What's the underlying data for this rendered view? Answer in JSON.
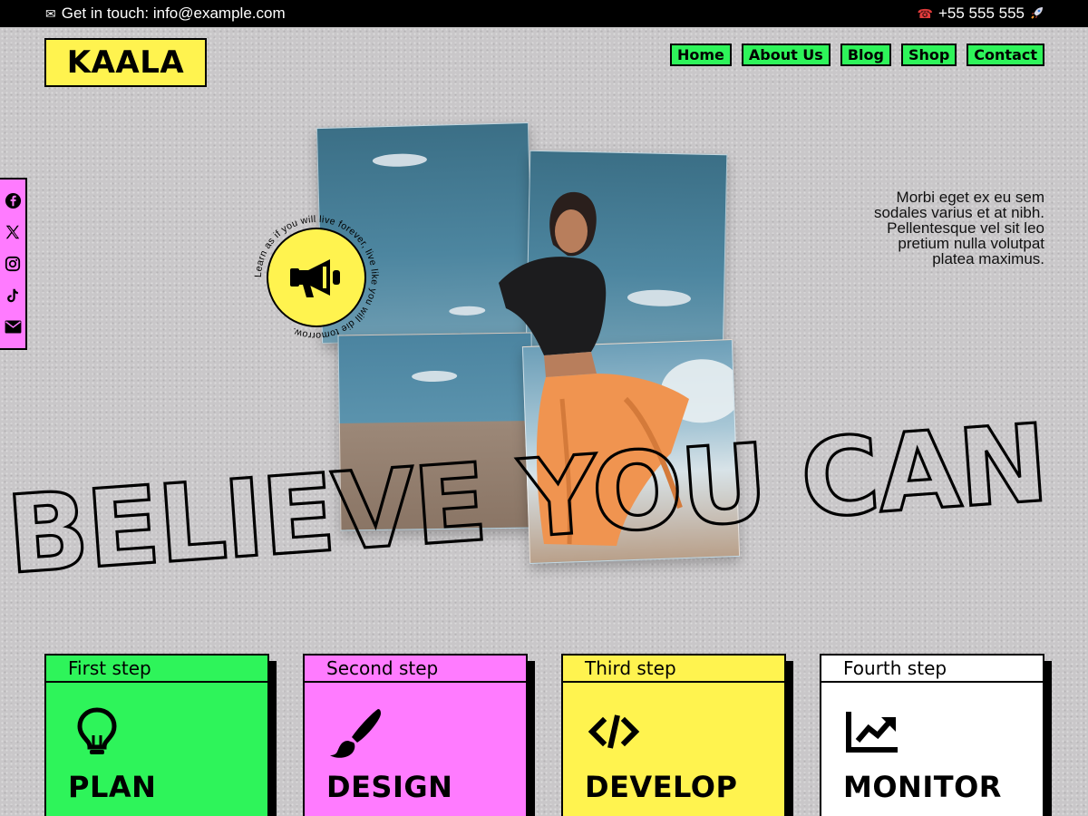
{
  "topbar": {
    "email_label": "Get in touch: info@example.com",
    "phone_label": "+55 555 555",
    "email_icon": "envelope-icon",
    "phone_icon": "telephone-icon",
    "rocket_icon": "rocket-icon"
  },
  "brand": {
    "logo": "KAALA"
  },
  "nav": {
    "items": [
      "Home",
      "About Us",
      "Blog",
      "Shop",
      "Contact"
    ]
  },
  "social": [
    "facebook-icon",
    "x-icon",
    "instagram-icon",
    "tiktok-icon",
    "email-icon"
  ],
  "hero": {
    "blurb_lines": [
      "Morbi eget ex eu sem",
      "sodales varius et at nibh.",
      "Pellentesque vel sit leo",
      "pretium nulla volutpat",
      "platea maximus."
    ],
    "badge_text": "Learn as if you will live forever, live like you will die tomorrow.",
    "headline": "BELIEVE YOU CAN"
  },
  "steps": [
    {
      "label": "First step",
      "title": "PLAN",
      "icon": "lightbulb-icon",
      "color": "#2ef45a"
    },
    {
      "label": "Second step",
      "title": "DESIGN",
      "icon": "paintbrush-icon",
      "color": "#ff7bff"
    },
    {
      "label": "Third step",
      "title": "DEVELOP",
      "icon": "code-icon",
      "color": "#fff34f"
    },
    {
      "label": "Fourth step",
      "title": "MONITOR",
      "icon": "chart-line-icon",
      "color": "#ffffff"
    }
  ],
  "colors": {
    "green": "#2ef45a",
    "pink": "#ff7bff",
    "yellow": "#fff34f",
    "black": "#000000"
  }
}
